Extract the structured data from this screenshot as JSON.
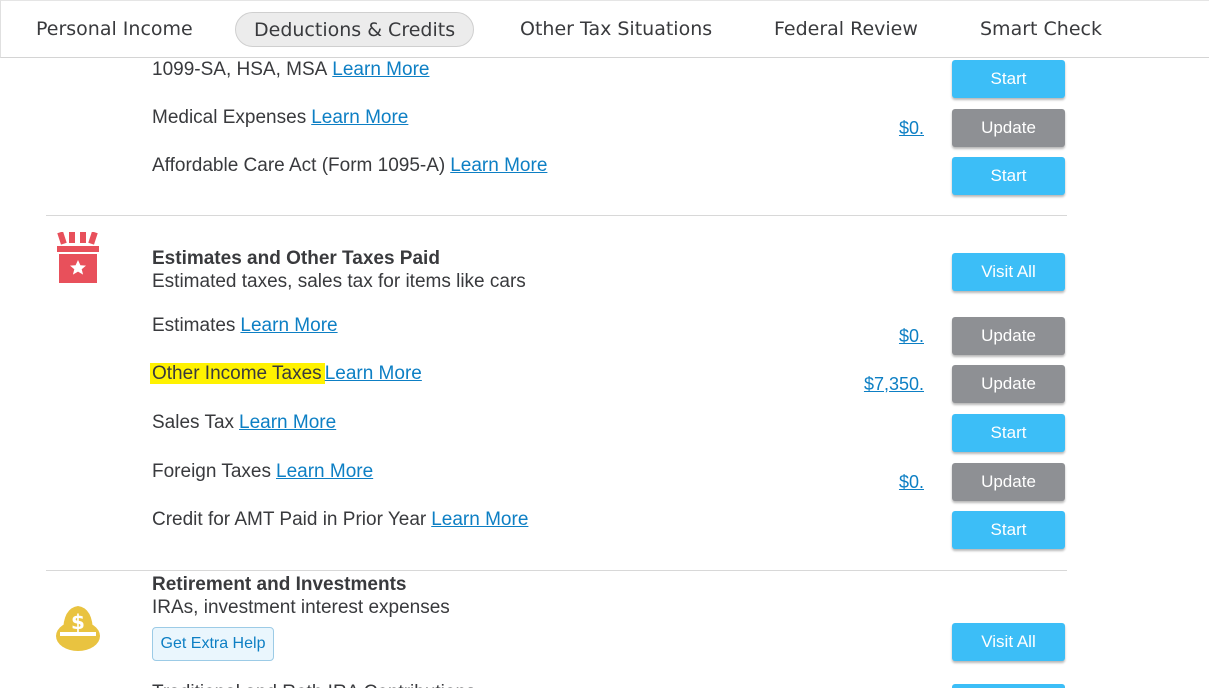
{
  "nav": {
    "tabs": [
      {
        "label": "Personal Income"
      },
      {
        "label": "Deductions & Credits"
      },
      {
        "label": "Other Tax Situations"
      },
      {
        "label": "Federal Review"
      },
      {
        "label": "Smart Check"
      }
    ]
  },
  "learn_more": "Learn More",
  "medical": {
    "rows": [
      {
        "label": "1099-SA, HSA, MSA",
        "button": "Start"
      },
      {
        "label": "Medical Expenses",
        "amount": "$0.",
        "button": "Update"
      },
      {
        "label": "Affordable Care Act (Form 1095-A)",
        "button": "Start"
      }
    ]
  },
  "estimates": {
    "title": "Estimates and Other Taxes Paid",
    "subtitle": "Estimated taxes, sales tax for items like cars",
    "visit_all": "Visit All",
    "icon": "gift-box-star-icon",
    "rows": [
      {
        "label": "Estimates",
        "amount": "$0.",
        "button": "Update"
      },
      {
        "label": "Other Income Taxes",
        "amount": "$7,350.",
        "button": "Update",
        "highlighted": true
      },
      {
        "label": "Sales Tax",
        "button": "Start"
      },
      {
        "label": "Foreign Taxes",
        "amount": "$0.",
        "button": "Update"
      },
      {
        "label": "Credit for AMT Paid in Prior Year",
        "button": "Start"
      }
    ]
  },
  "retirement": {
    "title": "Retirement and Investments",
    "subtitle": "IRAs, investment interest expenses",
    "extra_help": "Get Extra Help",
    "visit_all": "Visit All",
    "icon": "money-bag-icon",
    "cutoff_label": "Traditional and Roth IRA Contributions"
  },
  "colors": {
    "link": "#0d7fc4",
    "start_button": "#3cbef7",
    "update_button": "#8e9094",
    "highlight": "#fff200",
    "estimates_icon": "#e8505b",
    "retirement_icon": "#e9c340"
  }
}
